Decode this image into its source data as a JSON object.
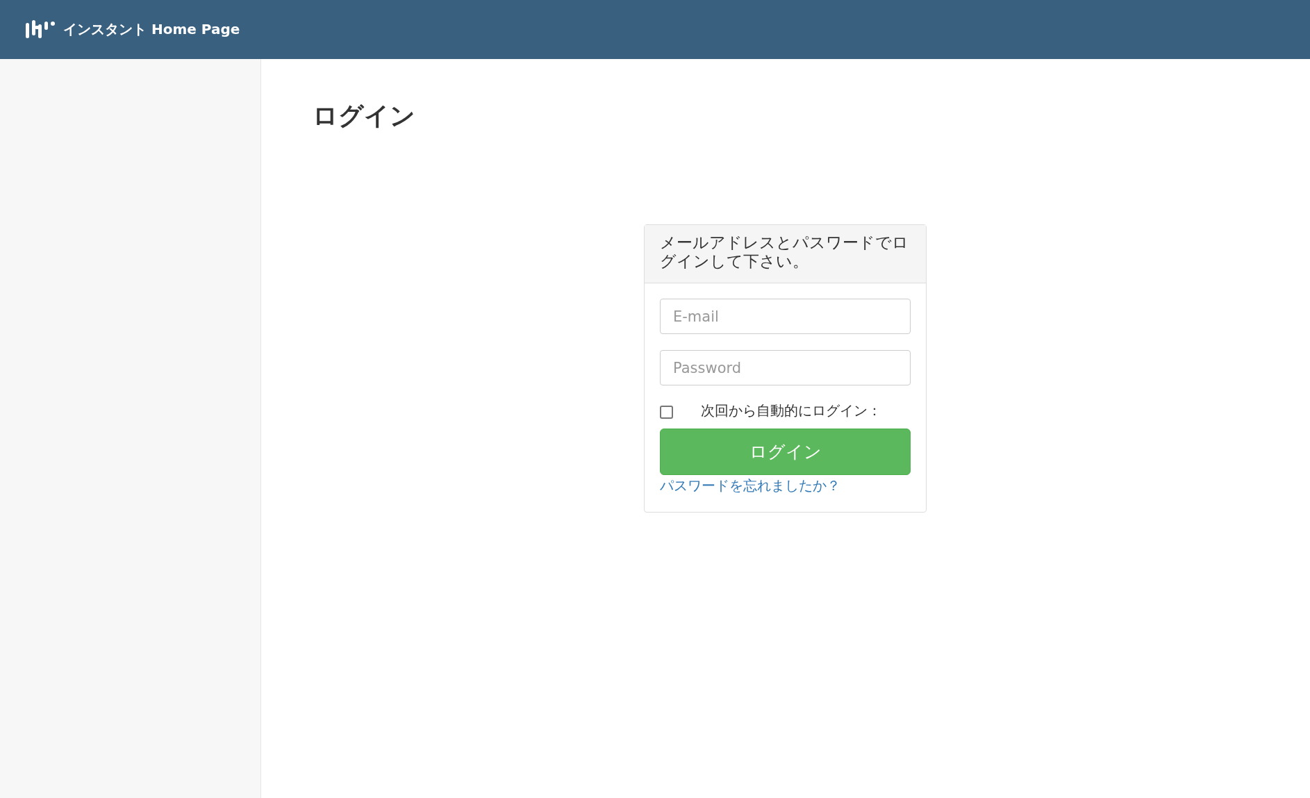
{
  "header": {
    "brand": "インスタント Home Page"
  },
  "page_title": "ログイン",
  "login_card": {
    "heading": "メールアドレスとパスワードでログインして下さい。",
    "email": {
      "placeholder": "E-mail"
    },
    "password": {
      "placeholder": "Password"
    },
    "remember": {
      "label": "次回から自動的にログイン：",
      "checked": false
    },
    "submit": "ログイン",
    "forgot_link": "パスワードを忘れましたか？"
  }
}
